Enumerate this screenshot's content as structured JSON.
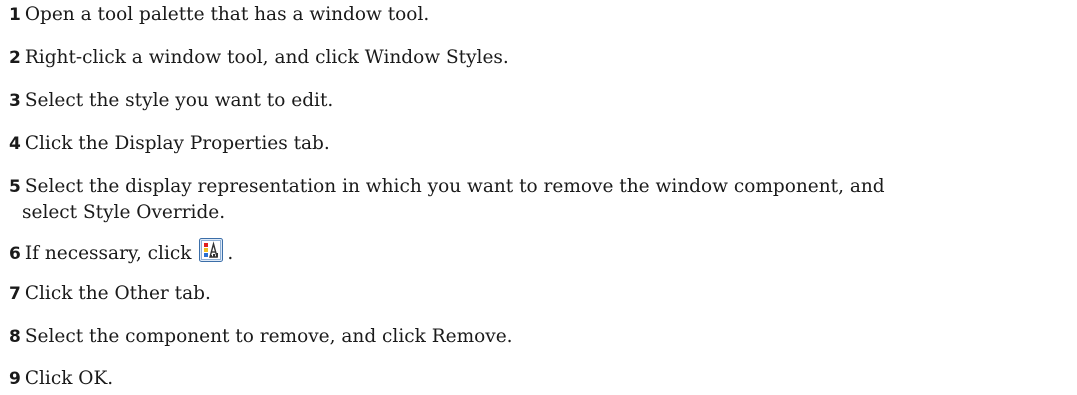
{
  "steps": [
    {
      "num": "1",
      "text": "Open a tool palette that has a window tool."
    },
    {
      "num": "2",
      "text": "Right-click a window tool, and click Window Styles."
    },
    {
      "num": "3",
      "text": "Select the style you want to edit."
    },
    {
      "num": "4",
      "text": "Click the Display Properties tab."
    },
    {
      "num": "5",
      "text": "Select the display representation in which you want to remove the window component, and",
      "text2": "select Style Override."
    },
    {
      "num": "6",
      "text": "If necessary, click",
      "icon": "display-properties-icon",
      "suffix": "."
    },
    {
      "num": "7",
      "text": "Click the Other tab."
    },
    {
      "num": "8",
      "text": "Select the component to remove, and click Remove."
    },
    {
      "num": "9",
      "text": "Click OK."
    }
  ]
}
